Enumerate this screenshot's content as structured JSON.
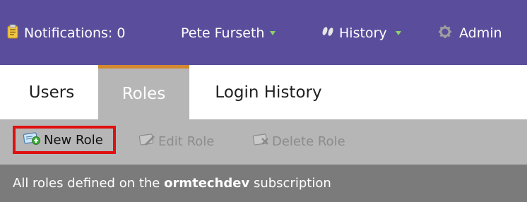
{
  "header": {
    "notifications_label": "Notifications: 0",
    "user_name": "Pete Furseth",
    "history_label": "History",
    "admin_label": "Admin"
  },
  "tabs": [
    {
      "label": "Users"
    },
    {
      "label": "Roles",
      "active": true
    },
    {
      "label": "Login History"
    }
  ],
  "toolbar": {
    "new_role_label": "New Role",
    "edit_role_label": "Edit Role",
    "delete_role_label": "Delete Role"
  },
  "subtitle": {
    "prefix": "All roles defined on the ",
    "subscription": "ormtechdev",
    "suffix": " subscription"
  },
  "colors": {
    "header_bg": "#5a4e9c",
    "active_tab_accent": "#d4892f",
    "highlight_border": "#e01010"
  }
}
